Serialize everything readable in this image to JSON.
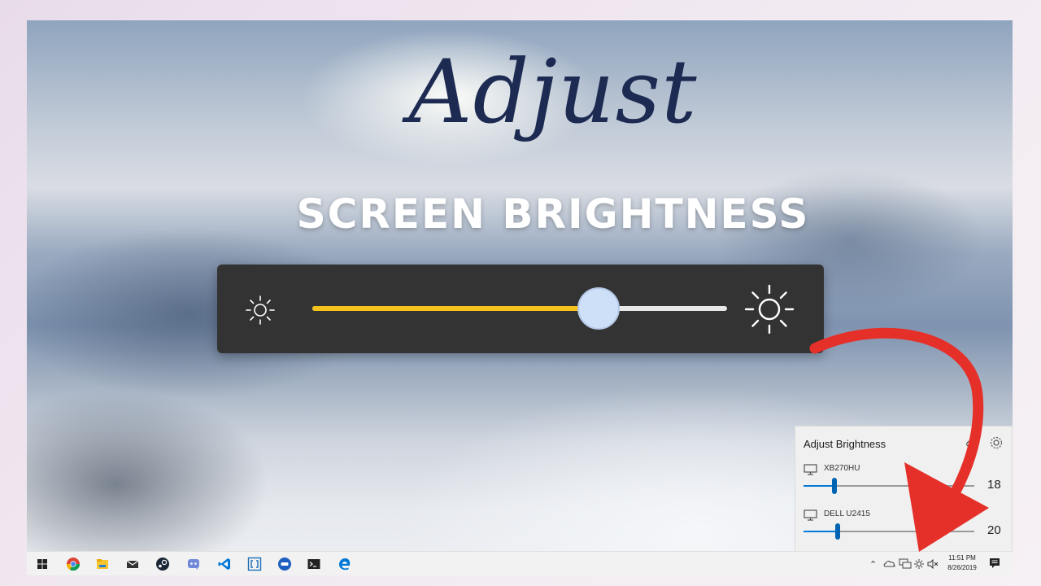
{
  "headline": {
    "script": "Adjust",
    "main": "SCREEN BRIGHTNESS"
  },
  "big_slider": {
    "level_percent": 69,
    "left_icon": "sun-dim-icon",
    "right_icon": "sun-bright-icon",
    "fill_color": "#f4c21b",
    "thumb_color": "#cde0f8"
  },
  "flyout": {
    "title": "Adjust Brightness",
    "icons": [
      "link-icon",
      "gear-icon"
    ],
    "monitors": [
      {
        "name": "XB270HU",
        "value": "18",
        "level": 18
      },
      {
        "name": "DELL U2415",
        "value": "20",
        "level": 20
      }
    ]
  },
  "taskbar": {
    "apps": [
      "windows-start-icon",
      "chrome-icon",
      "file-explorer-icon",
      "mail-icon",
      "steam-icon",
      "discord-icon",
      "vscode-icon",
      "brackets-icon",
      "dvd-icon",
      "terminal-icon",
      "edge-icon"
    ],
    "tray_icons": [
      "chevron-up-icon",
      "onedrive-icon",
      "network-icon",
      "brightness-icon",
      "volume-muted-icon"
    ],
    "time": "11:51 PM",
    "date": "8/26/2019"
  },
  "colors": {
    "accent_red": "#e5302a",
    "panel_dark": "#333333",
    "title_navy": "#1d2a52"
  }
}
